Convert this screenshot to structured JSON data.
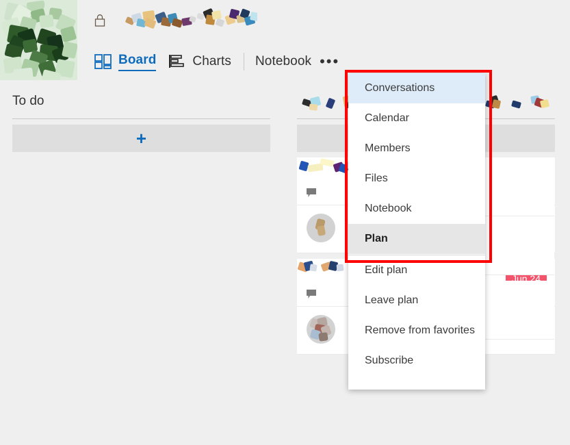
{
  "header": {
    "group_avatar_name": "group-avatar-image",
    "lock_icon": "lock-icon",
    "plan_title_redacted": "",
    "subtitle_redacted": ""
  },
  "tabs": [
    {
      "label": "Board",
      "icon": "board-icon",
      "active": true
    },
    {
      "label": "Charts",
      "icon": "charts-icon",
      "active": false
    },
    {
      "label": "Notebook",
      "icon": "",
      "active": false
    }
  ],
  "more_button": {
    "label": "•••",
    "icon": "ellipsis-icon"
  },
  "board": {
    "add_task_symbol": "+",
    "buckets": [
      {
        "title": "To do",
        "cards": []
      },
      {
        "title": "",
        "cards": [
          {
            "title_redacted": "",
            "has_comment": true,
            "has_avatar": true,
            "due": ""
          },
          {
            "title_redacted": "",
            "has_comment": true,
            "has_avatar": true,
            "due": "Jun 24"
          }
        ]
      },
      {
        "title": "",
        "cards": [
          {
            "title_redacted": "",
            "has_comment": false,
            "has_avatar": false,
            "due": ""
          },
          {
            "title_redacted": "",
            "has_comment": false,
            "has_avatar": false,
            "due": ""
          }
        ]
      }
    ]
  },
  "dropdown": {
    "group_one": [
      {
        "label": "Conversations",
        "state": "highlighted"
      },
      {
        "label": "Calendar",
        "state": "normal"
      },
      {
        "label": "Members",
        "state": "normal"
      },
      {
        "label": "Files",
        "state": "normal"
      },
      {
        "label": "Notebook",
        "state": "normal"
      },
      {
        "label": "Plan",
        "state": "selected"
      }
    ],
    "group_two": [
      {
        "label": "Edit plan"
      },
      {
        "label": "Leave plan"
      },
      {
        "label": "Remove from favorites"
      },
      {
        "label": "Subscribe"
      }
    ]
  },
  "annotation": {
    "color": "#ff0000",
    "shape": "rectangle"
  },
  "colors": {
    "accent": "#0f6cbd",
    "page_background": "#efefef",
    "card_background": "#ffffff",
    "menu_highlight": "#deecf9",
    "menu_selected": "#e6e6e6",
    "due_badge": "#f3546c",
    "annotation": "#ff0000"
  }
}
